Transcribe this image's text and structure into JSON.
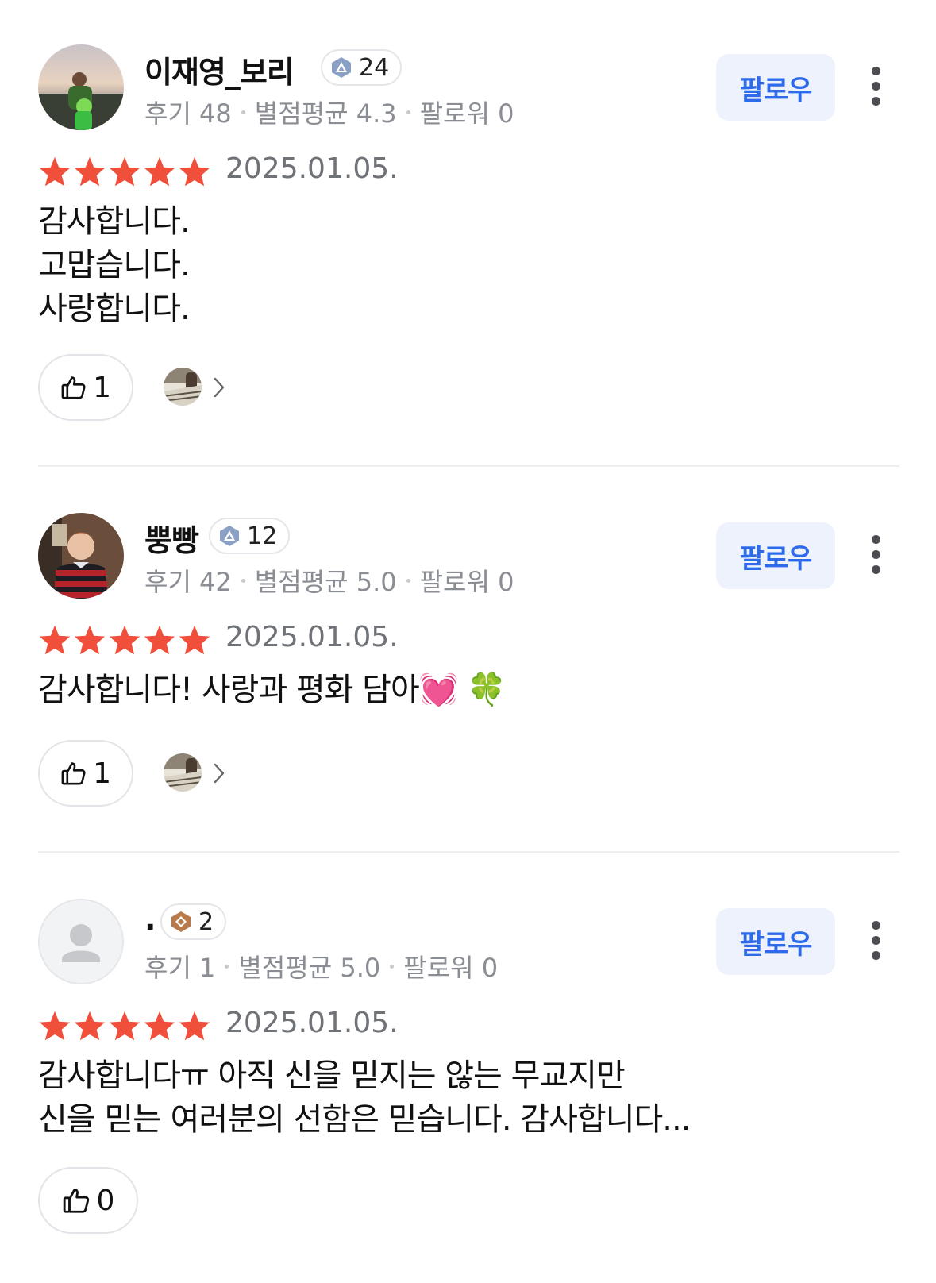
{
  "colors": {
    "star": "#ef4f3b",
    "follow_bg": "#eef2fd",
    "follow_text": "#2e6bea",
    "muted_text": "#8a8d93"
  },
  "reviews": [
    {
      "nickname": "이재영_보리",
      "badge_icon": "blue-level-icon",
      "badge_level": "24",
      "stats": {
        "reviews": "후기 48",
        "avg_rating": "별점평균 4.3",
        "followers": "팔로워 0"
      },
      "follow_label": "팔로우",
      "rating": 5,
      "date": "2025.01.05.",
      "text": "감사합니다.\n고맙습니다.\n사랑합니다.",
      "like_count": "1"
    },
    {
      "nickname": "뿡빵",
      "badge_icon": "blue-level-icon",
      "badge_level": "12",
      "stats": {
        "reviews": "후기 42",
        "avg_rating": "별점평균 5.0",
        "followers": "팔로워 0"
      },
      "follow_label": "팔로우",
      "rating": 5,
      "date": "2025.01.05.",
      "text": "감사합니다! 사랑과 평화 담아💓 🍀",
      "like_count": "1"
    },
    {
      "nickname": ".",
      "badge_icon": "bronze-level-icon",
      "badge_level": "2",
      "stats": {
        "reviews": "후기 1",
        "avg_rating": "별점평균 5.0",
        "followers": "팔로워 0"
      },
      "follow_label": "팔로우",
      "rating": 5,
      "date": "2025.01.05.",
      "text": "감사합니다ㅠ 아직 신을 믿지는 않는 무교지만\n신을 믿는 여러분의 선함은 믿습니다. 감사합니다...",
      "like_count": "0"
    }
  ]
}
